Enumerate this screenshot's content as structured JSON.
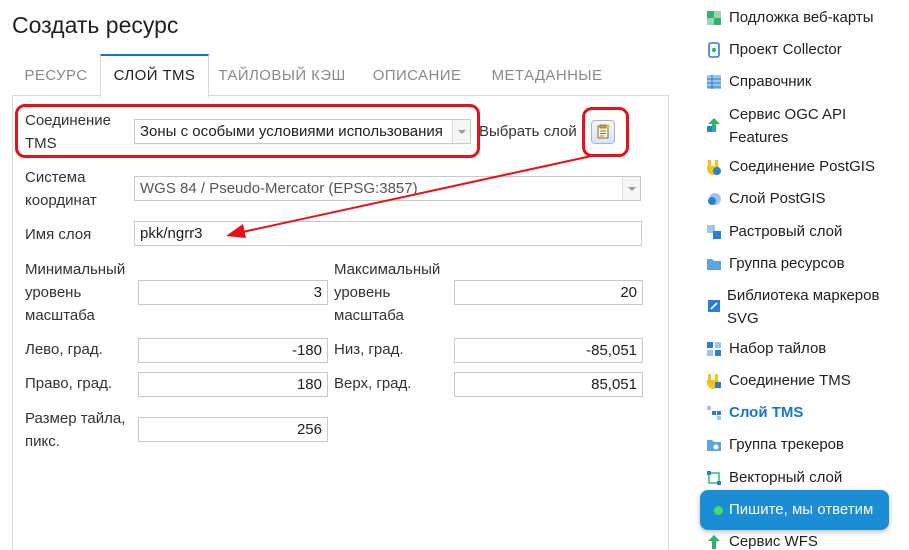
{
  "page_title": "Создать ресурс",
  "tabs": [
    {
      "label": "РЕСУРС"
    },
    {
      "label": "СЛОЙ TMS"
    },
    {
      "label": "ТАЙЛОВЫЙ КЭШ"
    },
    {
      "label": "ОПИСАНИЕ"
    },
    {
      "label": "МЕТАДАННЫЕ"
    }
  ],
  "form": {
    "connection_label_1": "Соединение",
    "connection_label_2": "TMS",
    "connection_value": "Зоны с особыми условиями использования",
    "pick_layer_label": "Выбрать слой",
    "crs_label_1": "Система",
    "crs_label_2": "координат",
    "crs_value": "WGS 84 / Pseudo-Mercator (EPSG:3857)",
    "layer_name_label": "Имя слоя",
    "layer_name_value": "pkk/ngrr3",
    "min_zoom_label_1": "Минимальный",
    "min_zoom_label_2": "уровень",
    "min_zoom_label_3": "масштаба",
    "min_zoom_value": "3",
    "max_zoom_label_1": "Максимальный",
    "max_zoom_label_2": "уровень",
    "max_zoom_label_3": "масштаба",
    "max_zoom_value": "20",
    "left_label": "Лево, град.",
    "left_value": "-180",
    "bottom_label": "Низ, град.",
    "bottom_value": "-85,051",
    "right_label": "Право, град.",
    "right_value": "180",
    "top_label": "Верх, град.",
    "top_value": "85,051",
    "tile_size_label_1": "Размер тайла,",
    "tile_size_label_2": "пикс.",
    "tile_size_value": "256"
  },
  "sidebar": {
    "items": [
      {
        "label": "Подложка веб-карты",
        "icon": "basemap-icon"
      },
      {
        "label": "Проект Collector",
        "icon": "collector-icon"
      },
      {
        "label": "Справочник",
        "icon": "lookup-table-icon"
      },
      {
        "label_1": "Сервис OGC API",
        "label_2": "Features",
        "icon": "ogc-service-icon"
      },
      {
        "label": "Соединение PostGIS",
        "icon": "postgis-connection-icon"
      },
      {
        "label": "Слой PostGIS",
        "icon": "postgis-layer-icon"
      },
      {
        "label": "Растровый слой",
        "icon": "raster-layer-icon"
      },
      {
        "label": "Группа ресурсов",
        "icon": "folder-icon"
      },
      {
        "label_1": "Библиотека маркеров",
        "label_2": "SVG",
        "icon": "svg-marker-library-icon"
      },
      {
        "label": "Набор тайлов",
        "icon": "tileset-icon"
      },
      {
        "label": "Соединение TMS",
        "icon": "tms-connection-icon"
      },
      {
        "label": "Слой TMS",
        "icon": "tms-layer-icon"
      },
      {
        "label": "Группа трекеров",
        "icon": "tracker-group-icon"
      },
      {
        "label": "Векторный слой",
        "icon": "vector-layer-icon"
      },
      {
        "label": "Сервис WFS",
        "icon": "wfs-service-icon"
      }
    ]
  },
  "chat_button": "Пишите, мы ответим",
  "colors": {
    "accent": "#1a73c9",
    "highlight": "#e8101a",
    "chat_bg": "#1a8dd4"
  }
}
